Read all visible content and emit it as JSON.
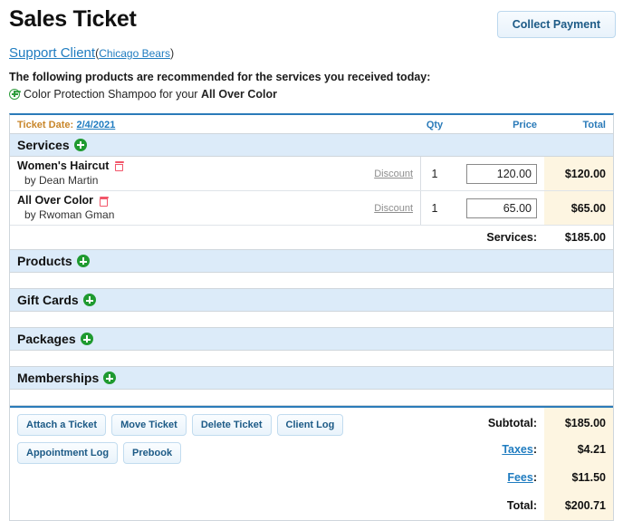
{
  "header": {
    "title": "Sales Ticket",
    "collect_payment_label": "Collect Payment"
  },
  "client": {
    "name": "Support Client",
    "open_paren": "(",
    "location": "Chicago Bears",
    "close_paren": ")"
  },
  "recommendations": {
    "heading": "The following products are recommended for the services you received today:",
    "items": [
      {
        "prefix": "Color Protection Shampoo for your ",
        "service": "All Over Color"
      }
    ]
  },
  "ticket": {
    "date_label": "Ticket Date:",
    "date_value": "2/4/2021",
    "columns": {
      "qty": "Qty",
      "price": "Price",
      "total": "Total"
    },
    "sections": [
      {
        "name": "Services",
        "items": [
          {
            "name": "Women's Haircut",
            "by": "by Dean Martin",
            "discount_label": "Discount",
            "qty": "1",
            "price": "120.00",
            "total": "$120.00"
          },
          {
            "name": "All Over Color",
            "by": "by Rwoman Gman",
            "discount_label": "Discount",
            "qty": "1",
            "price": "65.00",
            "total": "$65.00"
          }
        ],
        "subtotal_label": "Services:",
        "subtotal_value": "$185.00"
      },
      {
        "name": "Products",
        "items": [],
        "subtotal_label": "",
        "subtotal_value": ""
      },
      {
        "name": "Gift Cards",
        "items": [],
        "subtotal_label": "",
        "subtotal_value": ""
      },
      {
        "name": "Packages",
        "items": [],
        "subtotal_label": "",
        "subtotal_value": ""
      },
      {
        "name": "Memberships",
        "items": [],
        "subtotal_label": "",
        "subtotal_value": ""
      }
    ]
  },
  "footer": {
    "buttons_row1": [
      "Attach a Ticket",
      "Move Ticket",
      "Delete Ticket",
      "Client Log"
    ],
    "buttons_row2": [
      "Appointment Log",
      "Prebook"
    ],
    "totals": [
      {
        "label": "Subtotal",
        "is_link": false,
        "value": "$185.00"
      },
      {
        "label": "Taxes",
        "is_link": true,
        "value": "$4.21"
      },
      {
        "label": "Fees",
        "is_link": true,
        "value": "$11.50"
      },
      {
        "label": "Total",
        "is_link": false,
        "value": "$200.71"
      }
    ]
  },
  "colors": {
    "accent_blue": "#2b7bb9",
    "link_blue": "#1f7cc0",
    "section_bg": "#dcebf9",
    "total_cream": "#fdf5e1",
    "plus_green": "#1f9a30",
    "trash_red": "#f2566a",
    "date_label_orange": "#c8862a"
  }
}
